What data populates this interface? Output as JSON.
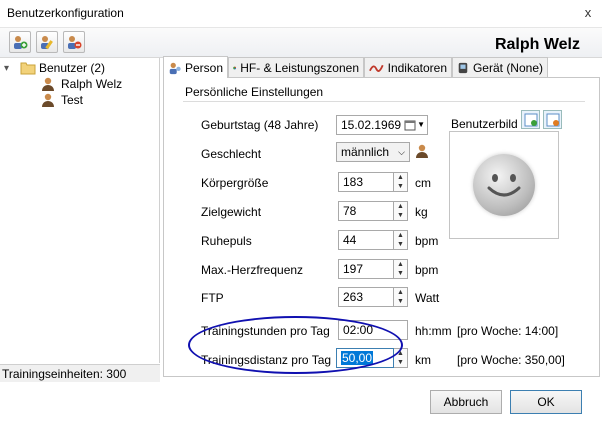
{
  "window": {
    "title": "Benutzerkonfiguration",
    "close_glyph": "x"
  },
  "header": {
    "user_name": "Ralph Welz"
  },
  "toolbar": {
    "buttons": [
      "add-user-icon",
      "edit-user-icon",
      "delete-user-icon"
    ]
  },
  "tree": {
    "root_label": "Benutzer (2)",
    "expander": "▾",
    "items": [
      "Ralph Welz",
      "Test"
    ]
  },
  "status": {
    "text": "Trainingseinheiten: 300"
  },
  "tabs": [
    {
      "label": "Person",
      "icon": "person-icon",
      "active": true
    },
    {
      "label": "HF- & Leistungszonen",
      "icon": "zones-icon",
      "active": false
    },
    {
      "label": "Indikatoren",
      "icon": "indicator-icon",
      "active": false
    },
    {
      "label": "Gerät (None)",
      "icon": "device-icon",
      "active": false
    }
  ],
  "section": {
    "title": "Persönliche Einstellungen"
  },
  "fields": {
    "birthday": {
      "label": "Geburtstag (48 Jahre)",
      "value": "15.02.1969"
    },
    "gender": {
      "label": "Geschlecht",
      "value": "männlich"
    },
    "height": {
      "label": "Körpergröße",
      "value": "183",
      "unit": "cm"
    },
    "target_weight": {
      "label": "Zielgewicht",
      "value": "78",
      "unit": "kg"
    },
    "resting_pulse": {
      "label": "Ruhepuls",
      "value": "44",
      "unit": "bpm"
    },
    "max_hr": {
      "label": "Max.-Herzfrequenz",
      "value": "197",
      "unit": "bpm"
    },
    "ftp": {
      "label": "FTP",
      "value": "263",
      "unit": "Watt"
    },
    "training_hours": {
      "label": "Trainingstunden pro Tag",
      "value": "02:00",
      "unit": "hh:mm",
      "weekly": "[pro Woche: 14:00]"
    },
    "training_distance": {
      "label": "Trainingsdistanz pro Tag",
      "value": "50,00",
      "unit": "km",
      "weekly": "[pro Woche: 350,00]"
    }
  },
  "avatar": {
    "label": "Benutzerbild"
  },
  "buttons": {
    "cancel": "Abbruch",
    "ok": "OK"
  },
  "colors": {
    "annotation_oval": "#1010b0",
    "selection": "#0078d7"
  }
}
